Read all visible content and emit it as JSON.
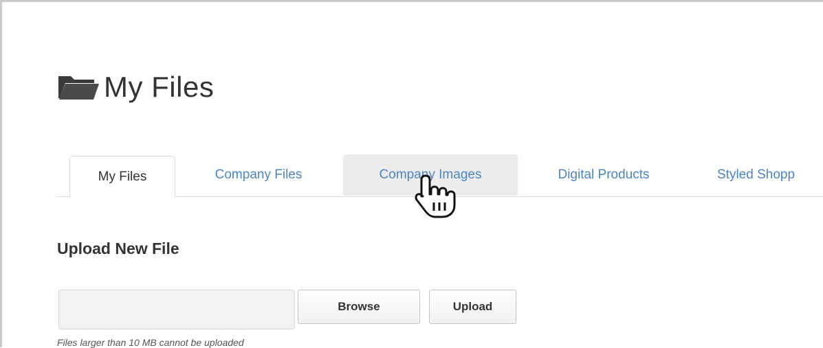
{
  "page": {
    "title": "My Files",
    "title_icon": "folder-icon"
  },
  "tabs": [
    {
      "label": "My Files",
      "state": "active"
    },
    {
      "label": "Company Files",
      "state": "normal"
    },
    {
      "label": "Company Images",
      "state": "hover"
    },
    {
      "label": "Digital Products",
      "state": "normal"
    },
    {
      "label": "Styled Shopp",
      "state": "normal"
    }
  ],
  "upload": {
    "section_title": "Upload New File",
    "file_value": "",
    "browse_label": "Browse",
    "upload_label": "Upload",
    "note": "Files larger than 10 MB cannot be uploaded"
  },
  "colors": {
    "link": "#4a86c5",
    "text": "#333333",
    "border": "#dcdcdc",
    "hover_tab": "#ececec"
  },
  "cursor": "hand-pointer-icon"
}
